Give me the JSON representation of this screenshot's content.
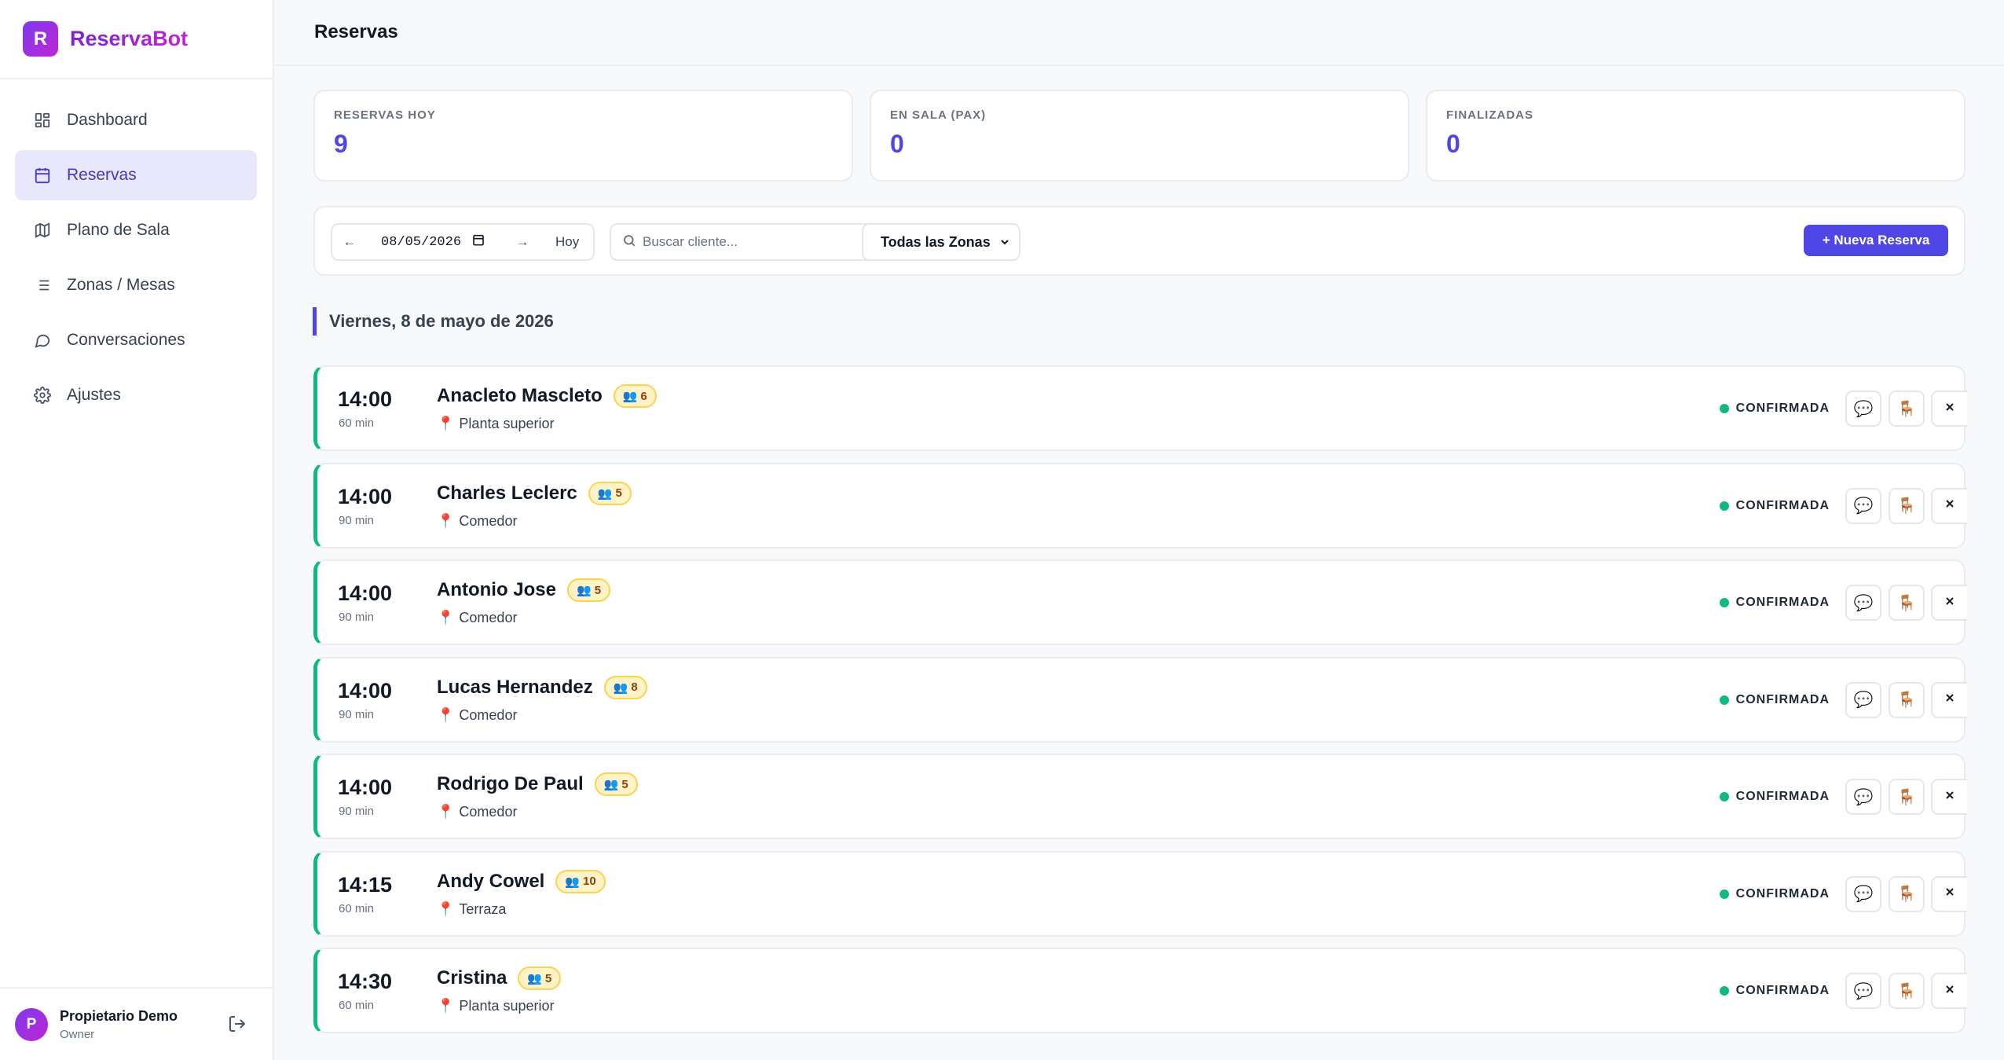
{
  "brand": {
    "logo_letter": "R",
    "name": "ReservaBot"
  },
  "nav": {
    "items": [
      {
        "label": "Dashboard",
        "icon": "dashboard-grid-icon"
      },
      {
        "label": "Reservas",
        "icon": "calendar-icon",
        "active": true
      },
      {
        "label": "Plano de Sala",
        "icon": "map-icon"
      },
      {
        "label": "Zonas / Mesas",
        "icon": "list-icon"
      },
      {
        "label": "Conversaciones",
        "icon": "chat-bubble-icon"
      },
      {
        "label": "Ajustes",
        "icon": "gear-icon"
      }
    ]
  },
  "user": {
    "initial": "P",
    "name": "Propietario Demo",
    "role": "Owner"
  },
  "header": {
    "title": "Reservas"
  },
  "stats": [
    {
      "label": "RESERVAS HOY",
      "value": "9"
    },
    {
      "label": "EN SALA (PAX)",
      "value": "0"
    },
    {
      "label": "FINALIZADAS",
      "value": "0"
    }
  ],
  "filters": {
    "prev": "←",
    "date": "08/05/2026",
    "next": "→",
    "today": "Hoy",
    "search_placeholder": "Buscar cliente...",
    "zone_selected": "Todas las Zonas",
    "new_button": "+ Nueva Reserva"
  },
  "day_heading": "Viernes, 8 de mayo de 2026",
  "reservations": [
    {
      "time": "14:00",
      "duration": "60 min",
      "name": "Anacleto Mascleto",
      "pax": "6",
      "zone": "Planta superior",
      "status": "CONFIRMADA"
    },
    {
      "time": "14:00",
      "duration": "90 min",
      "name": "Charles Leclerc",
      "pax": "5",
      "zone": "Comedor",
      "status": "CONFIRMADA"
    },
    {
      "time": "14:00",
      "duration": "90 min",
      "name": "Antonio Jose",
      "pax": "5",
      "zone": "Comedor",
      "status": "CONFIRMADA"
    },
    {
      "time": "14:00",
      "duration": "90 min",
      "name": "Lucas Hernandez",
      "pax": "8",
      "zone": "Comedor",
      "status": "CONFIRMADA"
    },
    {
      "time": "14:00",
      "duration": "90 min",
      "name": "Rodrigo De Paul",
      "pax": "5",
      "zone": "Comedor",
      "status": "CONFIRMADA"
    },
    {
      "time": "14:15",
      "duration": "60 min",
      "name": "Andy Cowel",
      "pax": "10",
      "zone": "Terraza",
      "status": "CONFIRMADA"
    },
    {
      "time": "14:30",
      "duration": "60 min",
      "name": "Cristina",
      "pax": "5",
      "zone": "Planta superior",
      "status": "CONFIRMADA"
    }
  ],
  "colors": {
    "accent": "#4f46e5",
    "status_confirmed": "#10b981",
    "pax_badge_bg": "#fef3c7"
  }
}
